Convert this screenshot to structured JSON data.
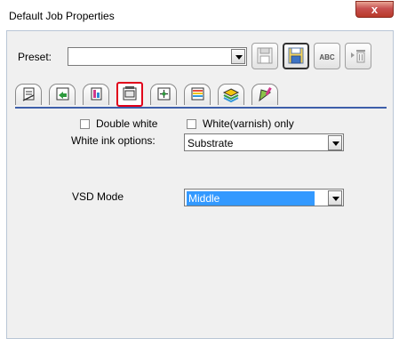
{
  "window": {
    "title": "Default Job Properties",
    "close_glyph": "x"
  },
  "preset": {
    "label": "Preset:",
    "value": ""
  },
  "toolbar": {
    "icons": [
      "save-preset-icon",
      "save-as-preset-icon",
      "rename-preset-icon",
      "delete-preset-icon"
    ],
    "abc_text": "ABC"
  },
  "tabs": {
    "icons": [
      "job-info-icon",
      "layout-icon",
      "color-icon",
      "white-ink-icon",
      "print-mode-icon",
      "color-bars-icon",
      "layers-icon",
      "paint-icon"
    ],
    "selected_index": 3
  },
  "white_ink": {
    "double_white_label": "Double white",
    "double_white_checked": false,
    "white_varnish_label": "White(varnish) only",
    "white_varnish_checked": false,
    "options_label": "White ink options:",
    "options_value": "Substrate"
  },
  "vsd": {
    "label": "VSD Mode",
    "value": "Middle"
  },
  "colors": {
    "tab_highlight": "#e0001a",
    "tab_line": "#3d5faa",
    "selection": "#3399ff"
  }
}
